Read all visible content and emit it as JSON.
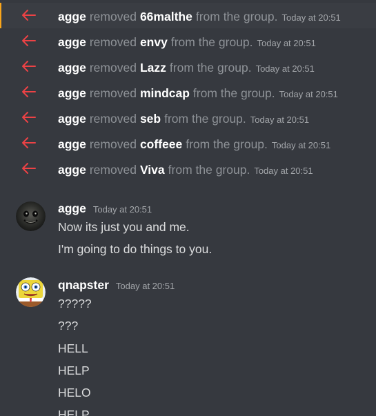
{
  "colors": {
    "background": "#36393f",
    "highlight_bar": "#faa61a",
    "arrow": "#ed4245",
    "muted_text": "#8e9297",
    "message_text": "#dcddde"
  },
  "system_messages": [
    {
      "actor": "agge",
      "verb": "removed",
      "target": "66malthe",
      "suffix": "from the group.",
      "timestamp": "Today at 20:51",
      "icon": "arrow-left-icon"
    },
    {
      "actor": "agge",
      "verb": "removed",
      "target": "envy",
      "suffix": "from the group.",
      "timestamp": "Today at 20:51",
      "icon": "arrow-left-icon"
    },
    {
      "actor": "agge",
      "verb": "removed",
      "target": "Lazz",
      "suffix": "from the group.",
      "timestamp": "Today at 20:51",
      "icon": "arrow-left-icon"
    },
    {
      "actor": "agge",
      "verb": "removed",
      "target": "mindcap",
      "suffix": "from the group.",
      "timestamp": "Today at 20:51",
      "icon": "arrow-left-icon"
    },
    {
      "actor": "agge",
      "verb": "removed",
      "target": "seb",
      "suffix": "from the group.",
      "timestamp": "Today at 20:51",
      "icon": "arrow-left-icon"
    },
    {
      "actor": "agge",
      "verb": "removed",
      "target": "coffeee",
      "suffix": "from the group.",
      "timestamp": "Today at 20:51",
      "icon": "arrow-left-icon"
    },
    {
      "actor": "agge",
      "verb": "removed",
      "target": "Viva",
      "suffix": "from the group.",
      "timestamp": "Today at 20:51",
      "icon": "arrow-left-icon"
    }
  ],
  "messages": [
    {
      "author": "agge",
      "timestamp": "Today at 20:51",
      "avatar": "avatar-dark-face",
      "lines": [
        "Now its just you and me.",
        "I'm going to do things to you."
      ]
    },
    {
      "author": "qnapster",
      "timestamp": "Today at 20:51",
      "avatar": "avatar-yellow-cartoon",
      "lines": [
        "?????",
        "???",
        "HELL",
        "HELP",
        "HELO",
        "HELP"
      ]
    }
  ]
}
